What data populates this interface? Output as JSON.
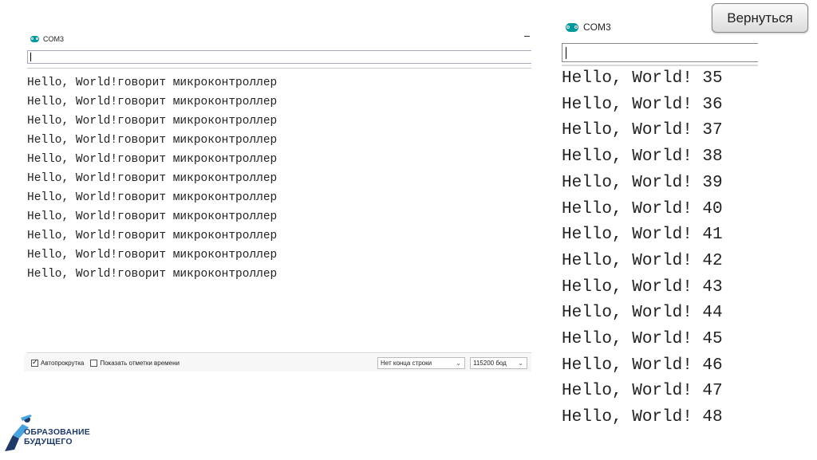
{
  "left_monitor": {
    "title": "COM3",
    "input_value": "",
    "output_lines": [
      "Hello, World!говорит микроконтроллер",
      "Hello, World!говорит микроконтроллер",
      "Hello, World!говорит микроконтроллер",
      "Hello, World!говорит микроконтроллер",
      "Hello, World!говорит микроконтроллер",
      "Hello, World!говорит микроконтроллер",
      "Hello, World!говорит микроконтроллер",
      "Hello, World!говорит микроконтроллер",
      "Hello, World!говорит микроконтроллер",
      "Hello, World!говорит микроконтроллер",
      "Hello, World!говорит микроконтроллер"
    ],
    "autoscroll_label": "Автопрокрутка",
    "autoscroll_checked": true,
    "timestamps_label": "Показать отметки времени",
    "timestamps_checked": false,
    "line_ending": "Нет конца строки",
    "baud_rate": "115200 бод"
  },
  "right_monitor": {
    "title": "COM3",
    "input_value": "",
    "output_lines": [
      "Hello, World! 35",
      "Hello, World! 36",
      "Hello, World! 37",
      "Hello, World! 38",
      "Hello, World! 39",
      "Hello, World! 40",
      "Hello, World! 41",
      "Hello, World! 42",
      "Hello, World! 43",
      "Hello, World! 44",
      "Hello, World! 45",
      "Hello, World! 46",
      "Hello, World! 47",
      "Hello, World! 48"
    ]
  },
  "back_button": {
    "label": "Вернуться"
  },
  "brand": {
    "line1": "ОБРАЗОВАНИЕ",
    "line2": "БУДУЩЕГО"
  },
  "colors": {
    "arduino_teal": "#00979c",
    "brand_blue": "#1f3a67",
    "brand_light": "#4aa3df"
  }
}
